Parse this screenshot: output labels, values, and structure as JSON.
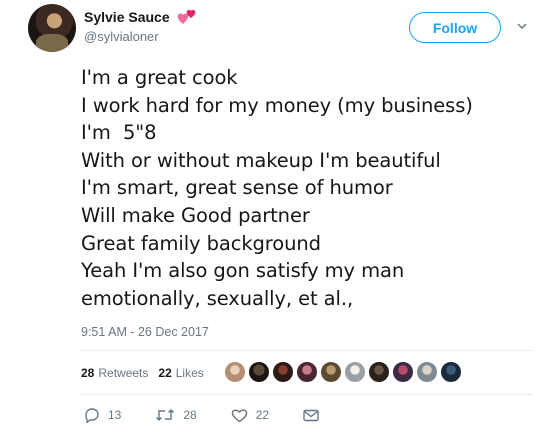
{
  "tweet": {
    "display_name": "Sylvie Sauce",
    "handle": "@sylvialoner",
    "follow_label": "Follow",
    "lines": [
      "I'm a great cook",
      "I work hard for my money (my business)",
      "I'm  5\"8",
      "With or without makeup I'm beautiful",
      "I'm smart, great sense of humor",
      "Will make Good partner",
      "Great family background",
      "Yeah I'm also gon satisfy my man",
      "emotionally, sexually, et al.,"
    ],
    "timestamp": "9:51 AM - 26 Dec 2017"
  },
  "stats": {
    "retweets_count": "28",
    "retweets_label": "Retweets",
    "likes_count": "22",
    "likes_label": "Likes"
  },
  "actions": {
    "reply_count": "13",
    "retweet_count": "28",
    "like_count": "22"
  },
  "icons": {
    "heart": "two-hearts-icon",
    "caret": "chevron-down-icon",
    "reply": "reply-icon",
    "retweet": "retweet-icon",
    "like": "heart-icon",
    "message": "envelope-icon"
  },
  "colors": {
    "accent": "#1da1f2",
    "muted": "#657786",
    "heart": "#e0245e"
  }
}
